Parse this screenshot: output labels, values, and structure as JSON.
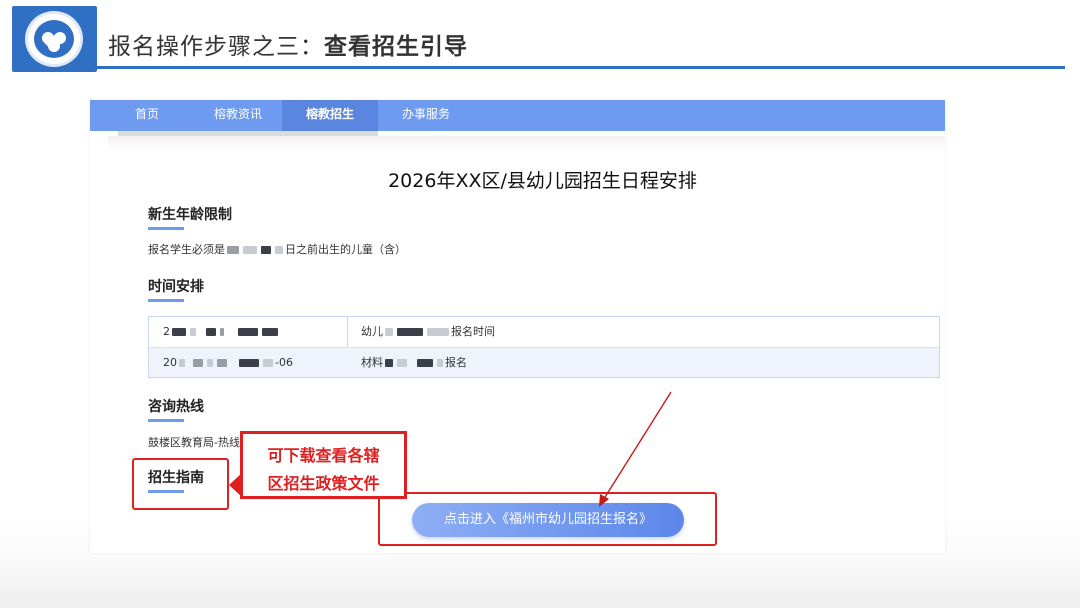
{
  "slide": {
    "title_prefix": "报名操作步骤之三：",
    "title_bold": "查看招生引导"
  },
  "nav": {
    "items": [
      {
        "label": "首页",
        "active": false
      },
      {
        "label": "榕教资讯",
        "active": false
      },
      {
        "label": "榕教招生",
        "active": true
      },
      {
        "label": "办事服务",
        "active": false
      }
    ]
  },
  "page": {
    "heading": "2026年XX区/县幼儿园招生日程安排",
    "sections": {
      "age_limit": {
        "title": "新生年龄限制",
        "text_before": "报名学生必须是",
        "text_after": "日之前出生的儿童（含）"
      },
      "schedule": {
        "title": "时间安排",
        "rows": [
          {
            "col1_prefix": "2",
            "col2_prefix": "幼儿",
            "col2_suffix": "报名时间"
          },
          {
            "col1_prefix": "20",
            "col1_suffix": "-06",
            "col2_prefix": "材料",
            "col2_suffix": "报名"
          }
        ]
      },
      "hotline": {
        "title": "咨询热线",
        "text": "鼓楼区教育局-热线"
      },
      "guide": {
        "title": "招生指南"
      }
    },
    "cta_label": "点击进入《福州市幼儿园招生报名》"
  },
  "annotation": {
    "line1": "可下载查看各辖",
    "line2": "区招生政策文件",
    "color": "#e02020"
  },
  "colors": {
    "brand_blue": "#2f6fc4",
    "nav_blue": "#6e9af0",
    "annotation_red": "#e02020"
  }
}
